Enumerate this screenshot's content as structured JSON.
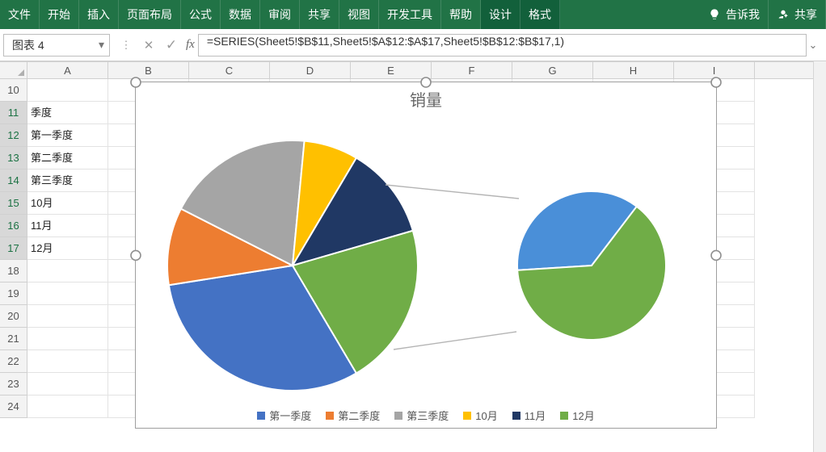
{
  "ribbon": {
    "tabs": [
      "文件",
      "开始",
      "插入",
      "页面布局",
      "公式",
      "数据",
      "审阅",
      "共享",
      "视图",
      "开发工具",
      "帮助"
    ],
    "context_tabs": [
      "设计",
      "格式"
    ],
    "tell_me": "告诉我",
    "share": "共享"
  },
  "namebox": {
    "value": "图表 4"
  },
  "formula_bar": {
    "cancel_label": "✕",
    "ok_label": "✓",
    "fx_label": "fx",
    "value": "=SERIES(Sheet5!$B$11,Sheet5!$A$12:$A$17,Sheet5!$B$12:$B$17,1)"
  },
  "columns": [
    "A",
    "B",
    "C",
    "D",
    "E",
    "F",
    "G",
    "H",
    "I"
  ],
  "rows": {
    "headers": [
      10,
      11,
      12,
      13,
      14,
      15,
      16,
      17,
      18,
      19,
      20,
      21,
      22,
      23,
      24
    ],
    "a_cells": {
      "11": "季度",
      "12": "第一季度",
      "13": "第二季度",
      "14": "第三季度",
      "15": "10月",
      "16": "11月",
      "17": "12月"
    }
  },
  "chart_data": {
    "type": "pie",
    "title": "销量",
    "categories": [
      "第一季度",
      "第二季度",
      "第三季度",
      "10月",
      "11月",
      "12月"
    ],
    "values": [
      31,
      10,
      19,
      7,
      12,
      21
    ],
    "colors": [
      "#4472C4",
      "#ED7D31",
      "#A5A5A5",
      "#FFC000",
      "#203864",
      "#70AD47"
    ],
    "secondary": {
      "categories": [
        "11月",
        "12月"
      ],
      "values": [
        12,
        21
      ],
      "colors": [
        "#4A8FD8",
        "#70AD47"
      ]
    },
    "legend": [
      "第一季度",
      "第二季度",
      "第三季度",
      "10月",
      "11月",
      "12月"
    ]
  }
}
